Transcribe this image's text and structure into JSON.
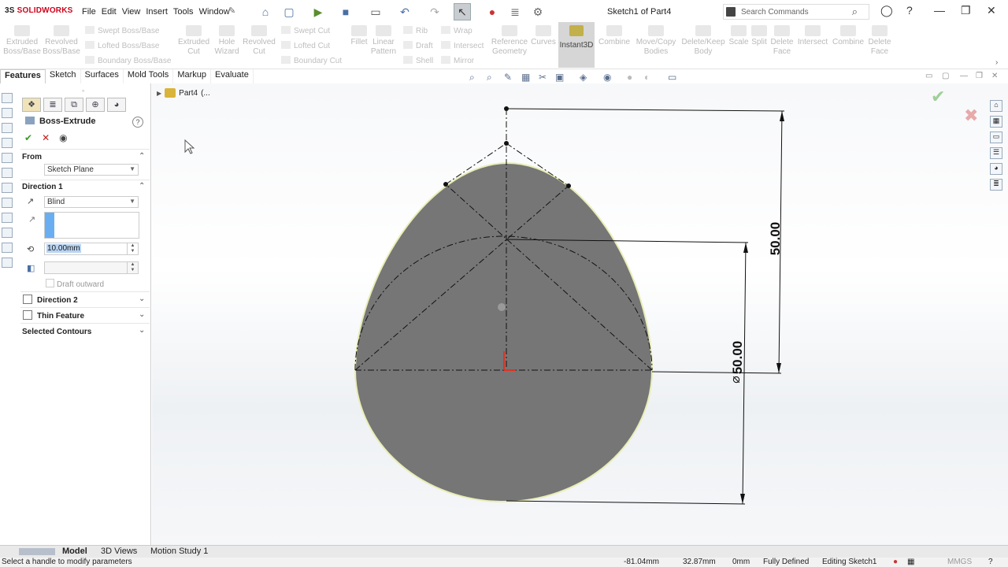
{
  "app": {
    "logo_prefix": "3S",
    "logo_name": "SOLIDWORKS",
    "document_title": "Sketch1 of Part4"
  },
  "menu": [
    "File",
    "Edit",
    "View",
    "Insert",
    "Tools",
    "Window"
  ],
  "search": {
    "placeholder": "Search Commands"
  },
  "ribbon": {
    "buttons": [
      {
        "label": "Extruded Boss/Base"
      },
      {
        "label": "Revolved Boss/Base"
      },
      {
        "label": "Extruded Cut"
      },
      {
        "label": "Hole Wizard"
      },
      {
        "label": "Revolved Cut"
      },
      {
        "label": "Fillet"
      },
      {
        "label": "Linear Pattern"
      },
      {
        "label": "Reference Geometry"
      },
      {
        "label": "Curves"
      },
      {
        "label": "Instant3D"
      },
      {
        "label": "Combine"
      },
      {
        "label": "Move/Copy Bodies"
      },
      {
        "label": "Delete/Keep Body"
      },
      {
        "label": "Scale"
      },
      {
        "label": "Split"
      },
      {
        "label": "Delete Face"
      },
      {
        "label": "Intersect"
      },
      {
        "label": "Combine"
      },
      {
        "label": "Delete Face"
      }
    ],
    "small": [
      "Swept Boss/Base",
      "Lofted Boss/Base",
      "Boundary Boss/Base",
      "Swept Cut",
      "Lofted Cut",
      "Boundary Cut",
      "Rib",
      "Draft",
      "Shell",
      "Wrap",
      "Intersect",
      "Mirror"
    ]
  },
  "tabs": [
    "Features",
    "Sketch",
    "Surfaces",
    "Mold Tools",
    "Markup",
    "Evaluate"
  ],
  "property_manager": {
    "title": "Boss-Extrude",
    "from_label": "From",
    "from_value": "Sketch Plane",
    "direction1_label": "Direction 1",
    "end_condition": "Blind",
    "depth": "10.00mm",
    "draft_outward": "Draft outward",
    "direction2_label": "Direction 2",
    "thin_feature_label": "Thin Feature",
    "selected_contours_label": "Selected Contours"
  },
  "tree": {
    "part": "Part4",
    "suffix": "(..."
  },
  "dimensions": {
    "linear": "50.00",
    "diameter": "50.00",
    "diameter_symbol": "⌀"
  },
  "bottom_tabs": [
    "Model",
    "3D Views",
    "Motion Study 1"
  ],
  "status": {
    "message": "Select a handle to modify parameters",
    "x": "-81.04mm",
    "y": "32.87mm",
    "z": "0mm",
    "state": "Fully Defined",
    "editing": "Editing Sketch1",
    "units": "MMGS"
  },
  "colors": {
    "accent": "#d0021b",
    "selection": "#6aaef2",
    "body": "#767676",
    "ok": "#3a9d23"
  }
}
